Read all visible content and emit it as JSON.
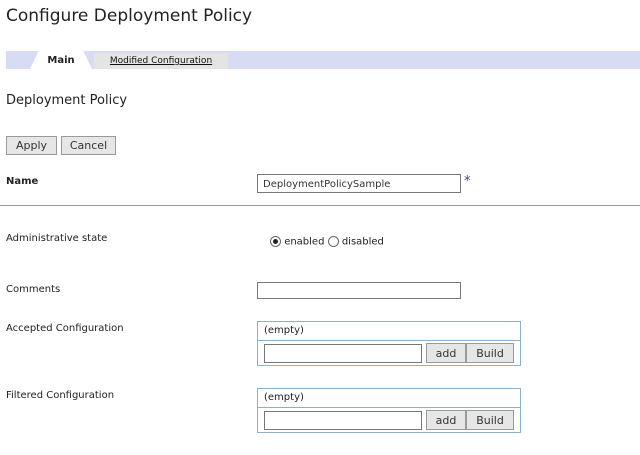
{
  "title": "Configure Deployment Policy",
  "tabs": {
    "main": "Main",
    "modified": "Modified Configuration"
  },
  "section_title": "Deployment Policy",
  "buttons": {
    "apply": "Apply",
    "cancel": "Cancel"
  },
  "name": {
    "label": "Name",
    "value": "DeploymentPolicySample",
    "required": "*"
  },
  "admin_state": {
    "label": "Administrative state",
    "options": [
      "enabled",
      "disabled"
    ],
    "selected": "enabled"
  },
  "comments": {
    "label": "Comments",
    "value": ""
  },
  "accepted": {
    "label": "Accepted Configuration",
    "list_text": "(empty)",
    "add": "add",
    "build": "Build"
  },
  "filtered": {
    "label": "Filtered Configuration",
    "list_text": "(empty)",
    "add": "add",
    "build": "Build"
  }
}
